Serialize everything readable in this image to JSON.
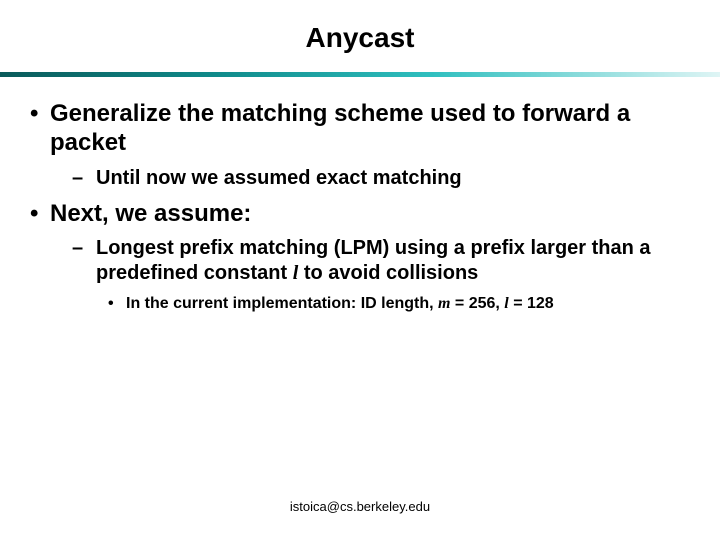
{
  "title": "Anycast",
  "bullets": {
    "b1": "Generalize the matching scheme used to forward a packet",
    "b1a": "Until now we assumed exact matching",
    "b2": "Next, we assume:",
    "b2a_pre": "Longest prefix matching (LPM) using a prefix larger than a predefined constant ",
    "b2a_var": "l",
    "b2a_post": " to avoid collisions",
    "b2a1_pre": "In the current implementation: ID length, ",
    "b2a1_m": "m",
    "b2a1_mid": " = 256, ",
    "b2a1_l": "l",
    "b2a1_post": " = 128"
  },
  "footer": "istoica@cs.berkeley.edu"
}
